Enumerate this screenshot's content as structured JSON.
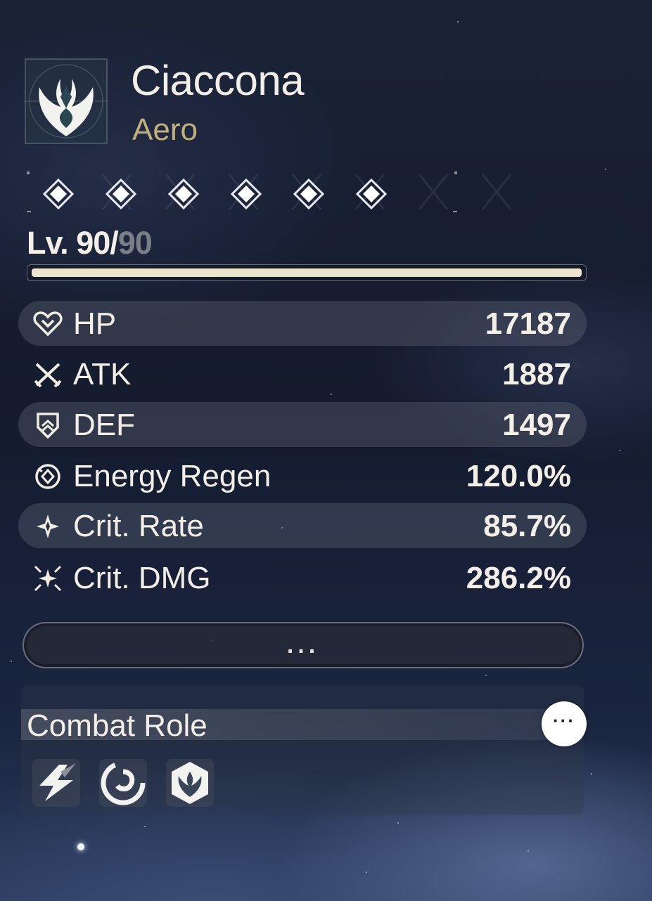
{
  "character": {
    "name": "Ciaccona",
    "element": "Aero",
    "emblem_icon": "aero-emblem-icon"
  },
  "resonance": {
    "nodes": 6,
    "icon": "resonance-diamond-icon"
  },
  "level": {
    "current": "90",
    "separator": "/",
    "max": "90",
    "prefix": "Lv. ",
    "progress": 1.0
  },
  "stats": [
    {
      "label": "HP",
      "value": "17187",
      "icon": "heart-icon"
    },
    {
      "label": "ATK",
      "value": "1887",
      "icon": "crossed-swords-icon"
    },
    {
      "label": "DEF",
      "value": "1497",
      "icon": "shield-icon"
    },
    {
      "label": "Energy Regen",
      "value": "120.0%",
      "icon": "energy-regen-icon"
    },
    {
      "label": "Crit. Rate",
      "value": "85.7%",
      "icon": "crit-rate-icon"
    },
    {
      "label": "Crit. DMG",
      "value": "286.2%",
      "icon": "crit-dmg-icon"
    }
  ],
  "more_button": {
    "label": "..."
  },
  "combat_role": {
    "title": "Combat Role",
    "info_label": "···",
    "roles": [
      {
        "icon": "lightning-role-icon"
      },
      {
        "icon": "swirl-role-icon"
      },
      {
        "icon": "aero-hex-role-icon"
      }
    ]
  },
  "colors": {
    "accent_gold": "#c2b07a",
    "text": "#f3efe6",
    "level_bar": "#ece5cc",
    "level_max": "#7a7f87"
  }
}
